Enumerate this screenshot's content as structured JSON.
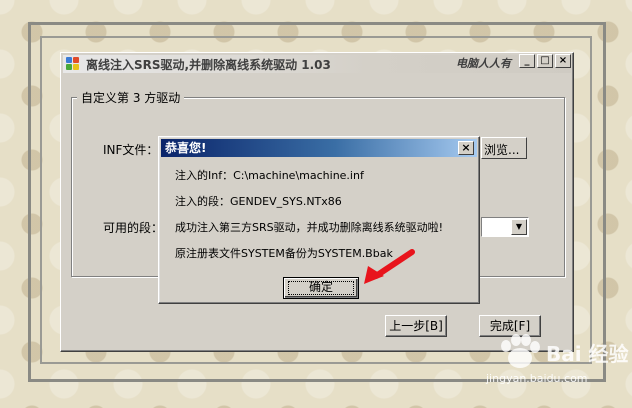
{
  "window": {
    "title": "离线注入SRS驱动,并删除离线系统驱动 1.03",
    "brand": "电脑人人有",
    "minimize_glyph": "_",
    "maximize_glyph": "□",
    "close_glyph": "×"
  },
  "wizard": {
    "group_label": "自定义第 3 方驱动",
    "inf_label": "INF文件：",
    "browse_label": "浏览...",
    "segment_label": "可用的段：",
    "back_button": "上一步[B]",
    "finish_button": "完成[F]"
  },
  "dialog": {
    "title": "恭喜您!",
    "close_glyph": "×",
    "lines": [
      "注入的Inf：C:\\machine\\machine.inf",
      "注入的段：GENDEV_SYS.NTx86",
      "成功注入第三方SRS驱动，并成功删除离线系统驱动啦!",
      "原注册表文件SYSTEM备份为SYSTEM.Bbak"
    ],
    "ok_button": "确定"
  },
  "watermark": {
    "text": "Bai 经验",
    "url": "jingyan.baidu.com"
  },
  "colors": {
    "annotation_arrow": "#e8141c",
    "dialog_titlebar": "#0a246a",
    "background": "#e6dfc7"
  }
}
